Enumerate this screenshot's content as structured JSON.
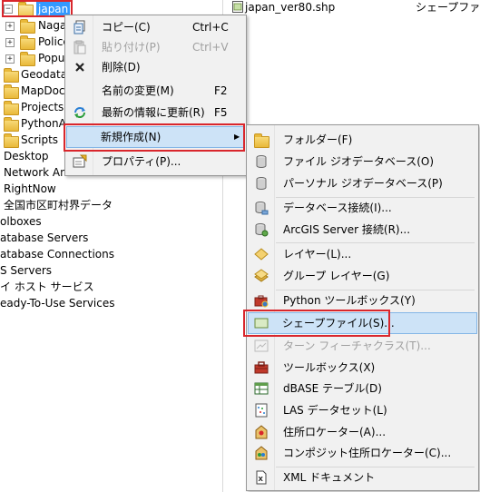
{
  "tree": {
    "items": [
      {
        "label": "japan",
        "selected": true
      },
      {
        "label": "Naga"
      },
      {
        "label": "Police"
      },
      {
        "label": "Popu"
      },
      {
        "label": "Geodata"
      },
      {
        "label": "MapDocu"
      },
      {
        "label": "Projects"
      },
      {
        "label": "PythonA"
      },
      {
        "label": "Scripts"
      },
      {
        "label": "Desktop"
      },
      {
        "label": "Network An"
      },
      {
        "label": "RightNow"
      },
      {
        "label": "全国市区町村界データ"
      },
      {
        "label": "olboxes"
      },
      {
        "label": "atabase Servers"
      },
      {
        "label": "atabase Connections"
      },
      {
        "label": "S Servers"
      },
      {
        "label": "イ ホスト サービス"
      },
      {
        "label": "eady-To-Use Services"
      }
    ]
  },
  "content": {
    "file_name": "japan_ver80.shp",
    "file_type": "シェープファ"
  },
  "context_menu": {
    "items": [
      {
        "label": "コピー(C)",
        "shortcut": "Ctrl+C"
      },
      {
        "label": "貼り付け(P)",
        "shortcut": "Ctrl+V",
        "disabled": true
      },
      {
        "label": "削除(D)"
      },
      {
        "label": "名前の変更(M)",
        "shortcut": "F2"
      },
      {
        "label": "最新の情報に更新(R)",
        "shortcut": "F5"
      },
      {
        "label": "新規作成(N)",
        "submenu_arrow": "▶"
      },
      {
        "label": "プロパティ(P)..."
      }
    ]
  },
  "new_submenu": {
    "items": [
      {
        "label": "フォルダー(F)"
      },
      {
        "label": "ファイル ジオデータベース(O)"
      },
      {
        "label": "パーソナル ジオデータベース(P)"
      },
      {
        "label": "データベース接続(I)..."
      },
      {
        "label": "ArcGIS Server 接続(R)..."
      },
      {
        "label": "レイヤー(L)..."
      },
      {
        "label": "グループ レイヤー(G)"
      },
      {
        "label": "Python ツールボックス(Y)"
      },
      {
        "label": "シェープファイル(S)..."
      },
      {
        "label": "ターン フィーチャクラス(T)...",
        "disabled": true
      },
      {
        "label": "ツールボックス(X)"
      },
      {
        "label": "dBASE テーブル(D)"
      },
      {
        "label": "LAS データセット(L)"
      },
      {
        "label": "住所ロケーター(A)..."
      },
      {
        "label": "コンポジット住所ロケーター(C)..."
      },
      {
        "label": "XML ドキュメント"
      }
    ]
  },
  "colors": {
    "highlight_box": "#d9262c",
    "hover_fill": "#cde3f7",
    "hover_border": "#84b6e6"
  }
}
